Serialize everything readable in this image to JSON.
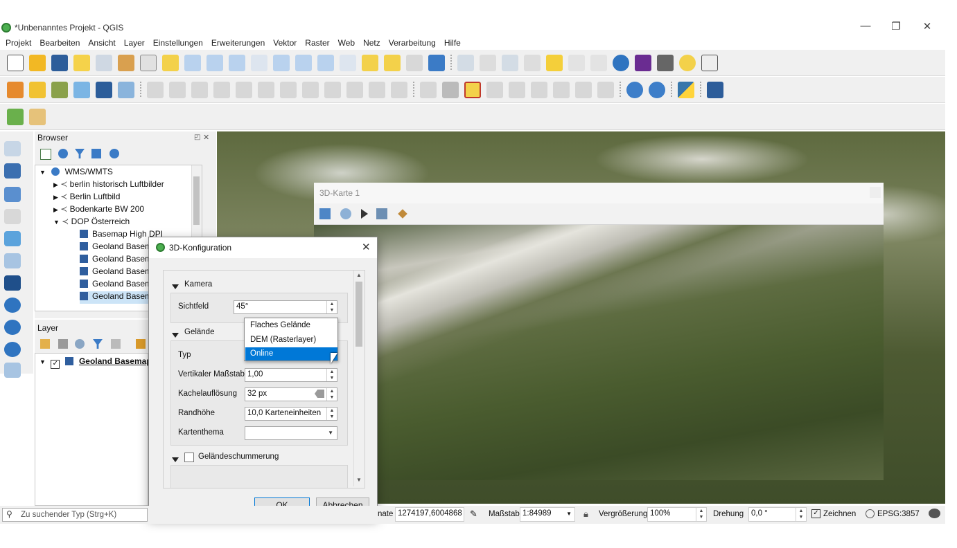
{
  "window": {
    "title": "*Unbenanntes Projekt - QGIS",
    "min": "—",
    "restore": "❐",
    "close": "✕"
  },
  "menu": [
    "Projekt",
    "Bearbeiten",
    "Ansicht",
    "Layer",
    "Einstellungen",
    "Erweiterungen",
    "Vektor",
    "Raster",
    "Web",
    "Netz",
    "Verarbeitung",
    "Hilfe"
  ],
  "browser": {
    "title": "Browser",
    "items": [
      {
        "label": "WMS/WMTS"
      },
      {
        "label": "berlin historisch Luftbilder"
      },
      {
        "label": "Berlin Luftbild"
      },
      {
        "label": "Bodenkarte BW 200"
      },
      {
        "label": "DOP Österreich"
      },
      {
        "label": "Basemap High DPI"
      },
      {
        "label": "Geoland Basem"
      },
      {
        "label": "Geoland Basem"
      },
      {
        "label": "Geoland Basem"
      },
      {
        "label": "Geoland Basem"
      },
      {
        "label": "Geoland Basem"
      }
    ]
  },
  "layers": {
    "title": "Layer",
    "item": "Geoland Basemap"
  },
  "map3d": {
    "title": "3D-Karte 1"
  },
  "dialog": {
    "title": "3D-Konfiguration",
    "camera": {
      "section": "Kamera",
      "fov_label": "Sichtfeld",
      "fov_value": "45°"
    },
    "terrain": {
      "section": "Gelände",
      "type_label": "Typ",
      "options": [
        "Flaches Gelände",
        "DEM (Rasterlayer)",
        "Online"
      ],
      "selected": "Online",
      "vscale_label": "Vertikaler Maßstab",
      "vscale_value": "1,00",
      "tile_label": "Kachelauflösung",
      "tile_value": "32 px",
      "skirt_label": "Randhöhe",
      "skirt_value": "10,0 Karteneinheiten",
      "theme_label": "Kartenthema",
      "theme_value": ""
    },
    "shading": {
      "label": "Geländeschummerung"
    },
    "ok": "OK",
    "cancel": "Abbrechen"
  },
  "status": {
    "search_placeholder": "Zu suchender Typ (Strg+K)",
    "coord_label": "nate",
    "coord_value": "1274197,6004868",
    "scale_label": "Maßstab",
    "scale_value": "1:84989",
    "mag_label": "Vergrößerung",
    "mag_value": "100%",
    "rot_label": "Drehung",
    "rot_value": "0,0 °",
    "render_label": "Zeichnen",
    "crs": "EPSG:3857"
  }
}
